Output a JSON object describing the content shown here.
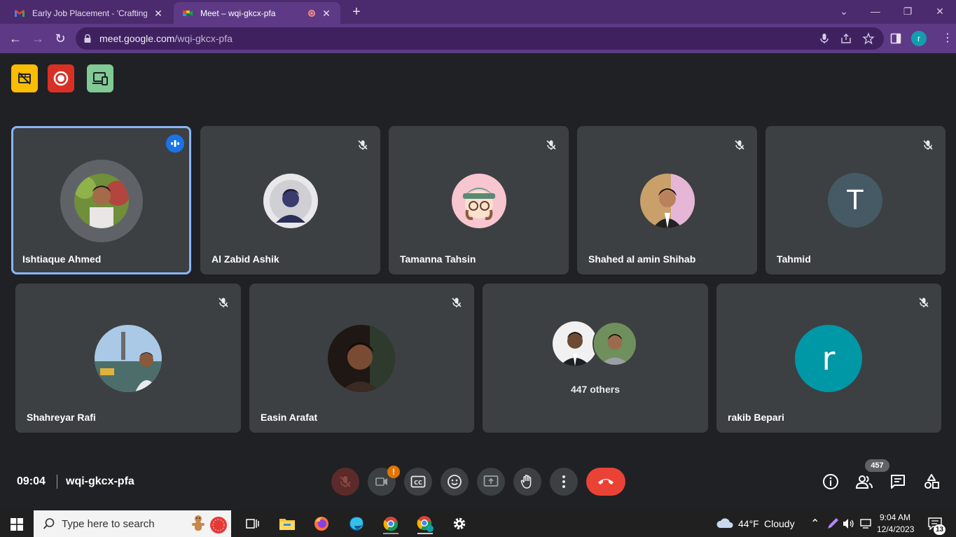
{
  "browser": {
    "tabs": [
      {
        "title": "Early Job Placement - 'Crafting y",
        "active": false,
        "icon": "gmail-icon"
      },
      {
        "title": "Meet – wqi-gkcx-pfa",
        "active": true,
        "icon": "meet-icon"
      }
    ],
    "new_tab_label": "+",
    "url_host": "meet.google.com",
    "url_path": "/wqi-gkcx-pfa",
    "profile_initial": "r"
  },
  "colors": {
    "browser_frame": "#4b2a6d",
    "browser_toolbar": "#5e3a86",
    "meet_background": "#202124",
    "tile": "#3c4043",
    "active_speaker_border": "#8ab4f8",
    "end_call": "#ea4335"
  },
  "meeting": {
    "top_indicators": [
      {
        "icon": "no-video-recording-icon",
        "color": "#fbbc04"
      },
      {
        "icon": "recording-icon",
        "color": "#d93025"
      },
      {
        "icon": "companion-devices-icon",
        "color": "#81c995"
      }
    ],
    "participants": [
      {
        "name": "Ishtiaque Ahmed",
        "avatar": "photo",
        "speaking": true
      },
      {
        "name": "Al Zabid Ashik",
        "avatar": "photo",
        "muted": true
      },
      {
        "name": "Tamanna Tahsin",
        "avatar": "illustration",
        "muted": true
      },
      {
        "name": "Shahed al amin Shihab",
        "avatar": "photo",
        "muted": true
      },
      {
        "name": "Tahmid",
        "avatar": "letter",
        "letter": "T",
        "muted": true
      },
      {
        "name": "Shahreyar Rafi",
        "avatar": "photo",
        "muted": true
      },
      {
        "name": "Easin Arafat",
        "avatar": "photo",
        "muted": true
      },
      {
        "name": "rakib Bepari",
        "avatar": "letter",
        "letter": "r",
        "muted": true
      }
    ],
    "others_label": "447 others",
    "time": "09:04",
    "meeting_code": "wqi-gkcx-pfa",
    "camera_alert": "!",
    "participant_count": "457"
  },
  "taskbar": {
    "search_placeholder": "Type here to search",
    "weather_temp": "44°F",
    "weather_desc": "Cloudy",
    "clock_time": "9:04 AM",
    "clock_date": "12/4/2023",
    "notification_count": "13"
  }
}
